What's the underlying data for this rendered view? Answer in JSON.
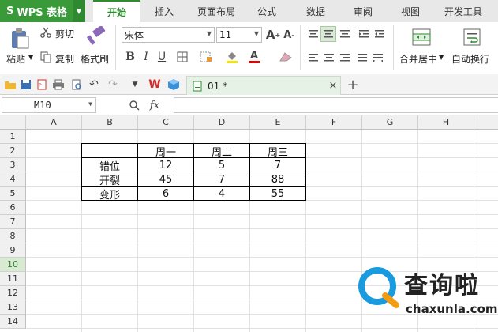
{
  "app": {
    "name": "WPS 表格"
  },
  "menu_tabs": [
    {
      "label": "开始",
      "active": true
    },
    {
      "label": "插入"
    },
    {
      "label": "页面布局"
    },
    {
      "label": "公式"
    },
    {
      "label": "数据"
    },
    {
      "label": "审阅"
    },
    {
      "label": "视图"
    },
    {
      "label": "开发工具"
    }
  ],
  "ribbon": {
    "cut": "剪切",
    "paste": "粘贴",
    "copy": "复制",
    "format_painter": "格式刷",
    "font_name": "宋体",
    "font_size": "11",
    "merge_center": "合并居中",
    "auto_wrap": "自动换行"
  },
  "doc_tab": {
    "label": "01 *"
  },
  "formula_bar": {
    "name_box": "M10",
    "fx": "fx"
  },
  "columns": [
    "A",
    "B",
    "C",
    "D",
    "E",
    "F",
    "G",
    "H"
  ],
  "rows": [
    "1",
    "2",
    "3",
    "4",
    "5",
    "6",
    "7",
    "8",
    "9",
    "10",
    "11",
    "12",
    "13",
    "14"
  ],
  "selected_row": "10",
  "table": {
    "header": [
      "",
      "周一",
      "周二",
      "周三"
    ],
    "rows": [
      [
        "错位",
        "12",
        "5",
        "7"
      ],
      [
        "开裂",
        "45",
        "7",
        "88"
      ],
      [
        "变形",
        "6",
        "4",
        "55"
      ]
    ]
  },
  "watermark": {
    "title": "查询啦",
    "url": "chaxunla.com"
  },
  "colors": {
    "accent": "#2e8b2e",
    "app_green": "#3a9a3a"
  }
}
